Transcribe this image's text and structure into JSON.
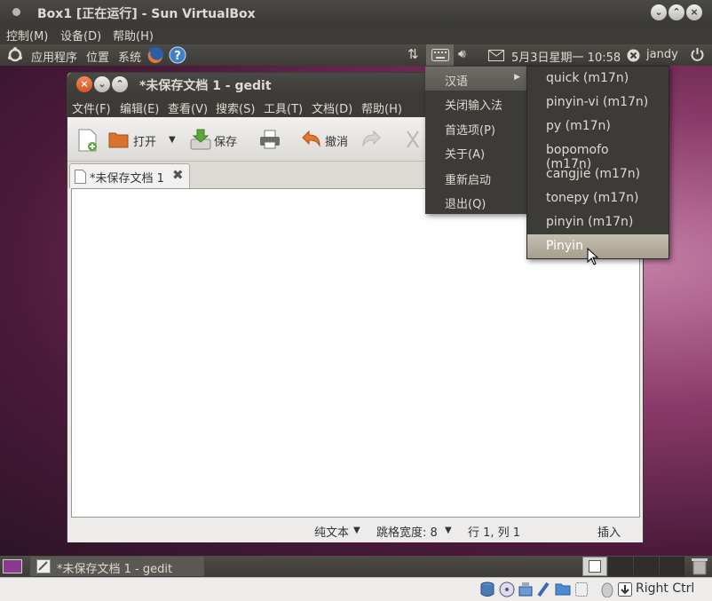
{
  "vbox": {
    "title": "Box1 [正在运行] - Sun VirtualBox",
    "menu": [
      "控制(M)",
      "设备(D)",
      "帮助(H)"
    ],
    "host_key": "Right Ctrl"
  },
  "top_panel": {
    "apps": "应用程序",
    "places": "位置",
    "system": "系统",
    "clock": "5月3日星期一 10:58",
    "user": "jandy"
  },
  "gedit": {
    "title": "*未保存文档 1 - gedit",
    "menu": [
      "文件(F)",
      "编辑(E)",
      "查看(V)",
      "搜索(S)",
      "工具(T)",
      "文档(D)",
      "帮助(H)"
    ],
    "toolbar": {
      "open": "打开",
      "save": "保存",
      "undo": "撤消"
    },
    "tab_label": "*未保存文档 1",
    "status": {
      "syntax": "纯文本",
      "tab_width": "跳格宽度: 8",
      "position": "行 1, 列 1",
      "mode": "插入"
    }
  },
  "im_menu": {
    "items": [
      "汉语",
      "关闭输入法",
      "首选项(P)",
      "关于(A)",
      "重新启动",
      "退出(Q)"
    ],
    "selected": "汉语"
  },
  "im_submenu": {
    "items": [
      "quick (m17n)",
      "pinyin-vi (m17n)",
      "py (m17n)",
      "bopomofo (m17n)",
      "cangjie (m17n)",
      "tonepy (m17n)",
      "pinyin (m17n)",
      "Pinyin"
    ],
    "selected": "Pinyin"
  },
  "taskbar": {
    "task_label": "*未保存文档 1 - gedit"
  }
}
